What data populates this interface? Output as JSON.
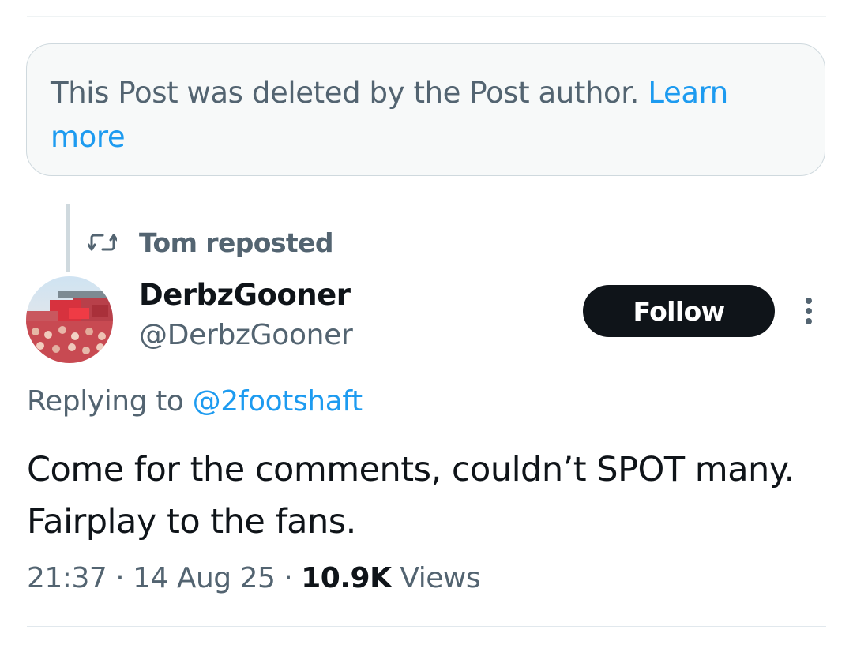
{
  "deleted_notice": {
    "text": "This Post was deleted by the Post author. ",
    "link_label": "Learn more"
  },
  "repost": {
    "icon": "repost-icon",
    "label": "Tom reposted"
  },
  "author": {
    "display_name": "DerbzGooner",
    "handle": "@DerbzGooner",
    "avatar_icon": "stadium-avatar"
  },
  "follow_button": {
    "label": "Follow"
  },
  "more_menu": {
    "icon": "more-vertical-icon"
  },
  "reply_context": {
    "prefix": "Replying to ",
    "handle": "@2footshaft"
  },
  "post": {
    "text": "Come for the comments, couldn’t SPOT many. Fairplay to the fans.",
    "time": "21:37",
    "separator": " · ",
    "date": "14 Aug 25",
    "views_count": "10.9K",
    "views_label": "Views"
  },
  "colors": {
    "link": "#1d9bf0",
    "secondary_text": "#536471",
    "primary_text": "#0f1419",
    "button_bg": "#0f1419",
    "notice_bg": "#f7f9f9"
  }
}
